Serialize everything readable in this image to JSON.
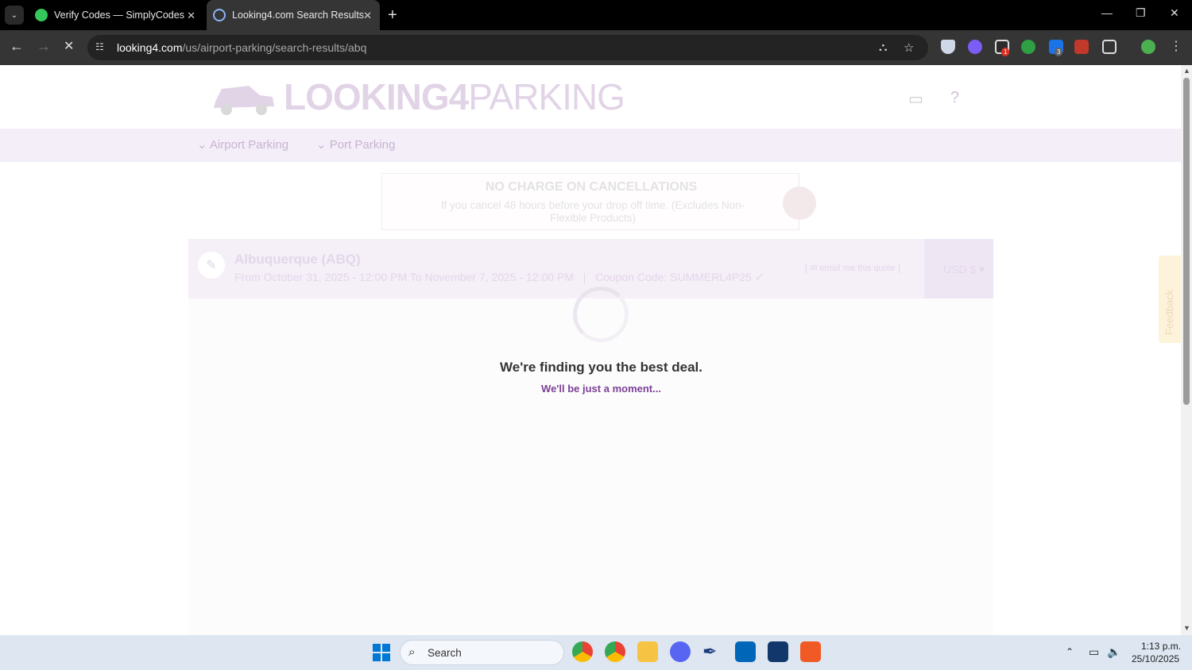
{
  "browser": {
    "tabs": [
      {
        "title": "Verify Codes — SimplyCodes",
        "active": false
      },
      {
        "title": "Looking4.com Search Results",
        "active": true
      }
    ],
    "url_host": "looking4.com",
    "url_path": "/us/airport-parking/search-results/abq",
    "extension_badges": [
      "1",
      "3"
    ]
  },
  "page": {
    "logo_bold": "LOOKING4",
    "logo_light": "PARKING",
    "nav": [
      "Airport Parking",
      "Port Parking"
    ],
    "cancel_title": "NO CHARGE ON CANCELLATIONS",
    "cancel_text": "If you cancel 48 hours before your drop off time. (Excludes Non-Flexible Products)",
    "location": "Albuquerque (ABQ)",
    "dates": "From October 31, 2025 - 12:00 PM To November 7, 2025 - 12:00 PM",
    "coupon": "Coupon Code: SUMMERL4P25",
    "email_quote": "email me this quote",
    "currency": "USD $",
    "finding": "We're finding you the best deal.",
    "moment": "We'll be just a moment...",
    "feedback": "Feedback"
  },
  "taskbar": {
    "search_label": "Search",
    "time": "1:13 p.m.",
    "date": "25/10/2025"
  },
  "colors": {
    "brand_purple": "#7b3f96",
    "chrome_dark": "#353535"
  }
}
